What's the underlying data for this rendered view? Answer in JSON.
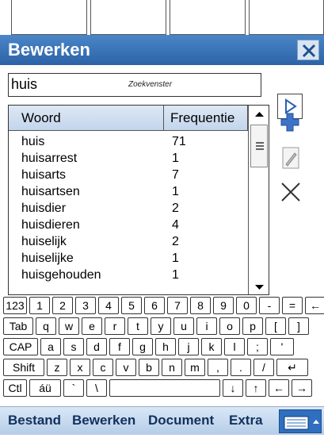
{
  "window": {
    "title": "Bewerken"
  },
  "search": {
    "value": "huis",
    "placeholder": "Zoekvenster"
  },
  "table": {
    "headers": [
      "Woord",
      "Frequentie"
    ],
    "rows": [
      [
        "huis",
        "71"
      ],
      [
        "huisarrest",
        "1"
      ],
      [
        "huisarts",
        "7"
      ],
      [
        "huisartsen",
        "1"
      ],
      [
        "huisdier",
        "2"
      ],
      [
        "huisdieren",
        "4"
      ],
      [
        "huiselijk",
        "2"
      ],
      [
        "huiselijke",
        "1"
      ],
      [
        "huisgehouden",
        "1"
      ]
    ]
  },
  "side_buttons": [
    "play-icon",
    "add-icon",
    "edit-icon",
    "delete-icon"
  ],
  "keyboard": {
    "row1": [
      "123",
      "1",
      "2",
      "3",
      "4",
      "5",
      "6",
      "7",
      "8",
      "9",
      "0",
      "-",
      "=",
      "←"
    ],
    "row2": [
      "Tab",
      "q",
      "w",
      "e",
      "r",
      "t",
      "y",
      "u",
      "i",
      "o",
      "p",
      "[",
      "]"
    ],
    "row3": [
      "CAP",
      "a",
      "s",
      "d",
      "f",
      "g",
      "h",
      "j",
      "k",
      "l",
      ";",
      "'"
    ],
    "row4": [
      "Shift",
      "z",
      "x",
      "c",
      "v",
      "b",
      "n",
      "m",
      ",",
      ".",
      "/",
      "↵"
    ],
    "row5": [
      "Ctl",
      "áü",
      "`",
      "\\",
      "",
      "↓",
      "↑",
      "←",
      "→"
    ]
  },
  "menubar": {
    "items": [
      "Bestand",
      "Bewerken",
      "Document",
      "Extra"
    ]
  },
  "colors": {
    "titlebar": "#3a76b8",
    "menubar": "#c6d9ef",
    "accent": "#2f6fc0"
  }
}
